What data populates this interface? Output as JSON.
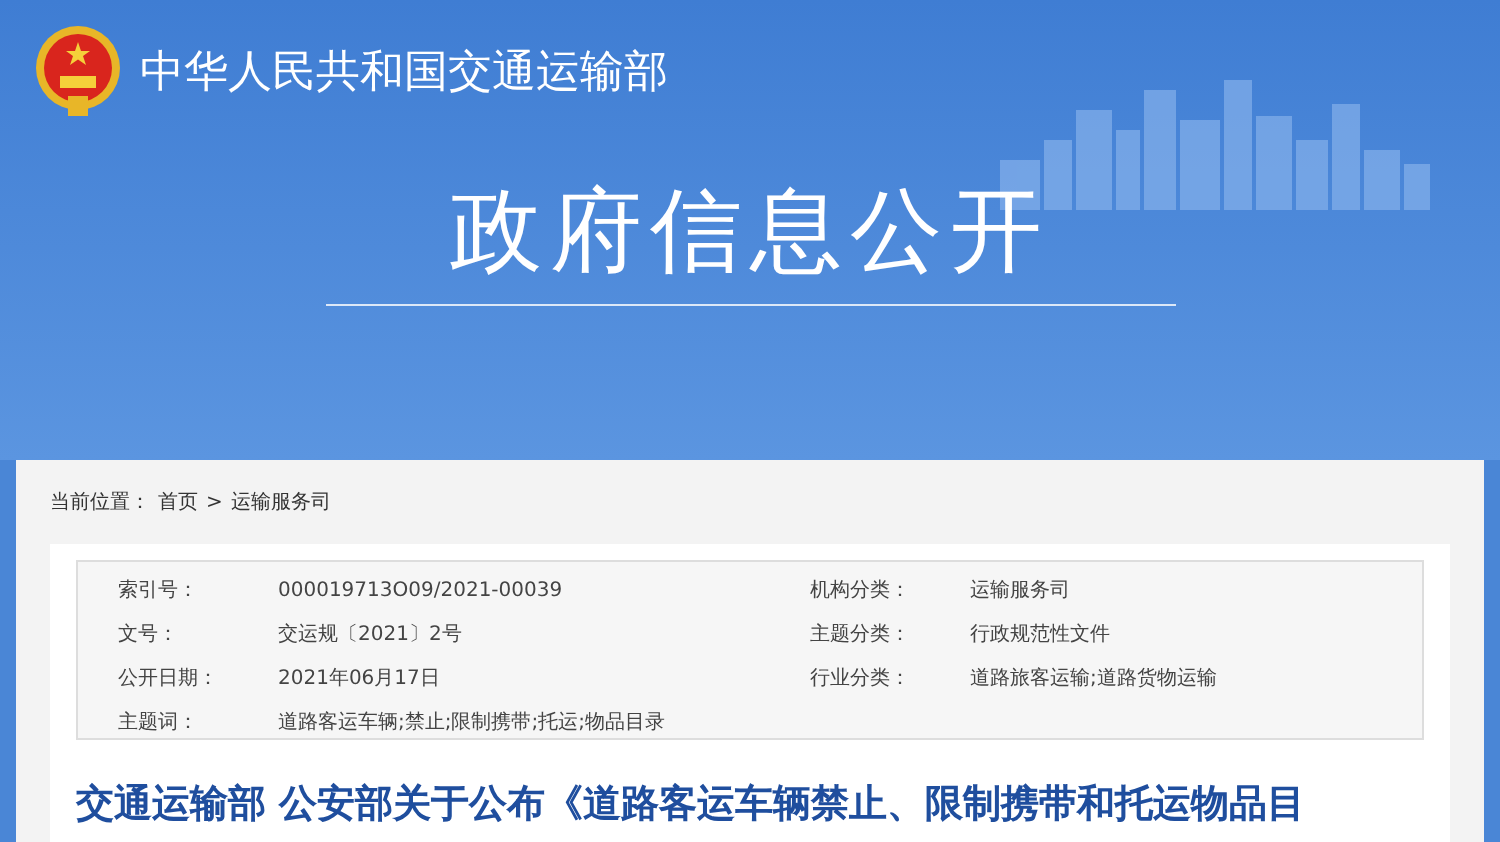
{
  "header": {
    "site_title": "中华人民共和国交通运输部",
    "page_title": "政府信息公开"
  },
  "breadcrumb": {
    "label": "当前位置：",
    "items": [
      "首页",
      "运输服务司"
    ],
    "separator": ">"
  },
  "info": {
    "left": [
      {
        "label": "索引号：",
        "value": "000019713O09/2021-00039"
      },
      {
        "label": "文号：",
        "value": "交运规〔2021〕2号"
      },
      {
        "label": "公开日期：",
        "value": "2021年06月17日"
      },
      {
        "label": "主题词：",
        "value": "道路客运车辆;禁止;限制携带;托运;物品目录"
      }
    ],
    "right": [
      {
        "label": "机构分类：",
        "value": "运输服务司"
      },
      {
        "label": "主题分类：",
        "value": "行政规范性文件"
      },
      {
        "label": "行业分类：",
        "value": "道路旅客运输;道路货物运输"
      }
    ]
  },
  "article": {
    "title": "交通运输部 公安部关于公布《道路客运车辆禁止、限制携带和托运物品目"
  }
}
